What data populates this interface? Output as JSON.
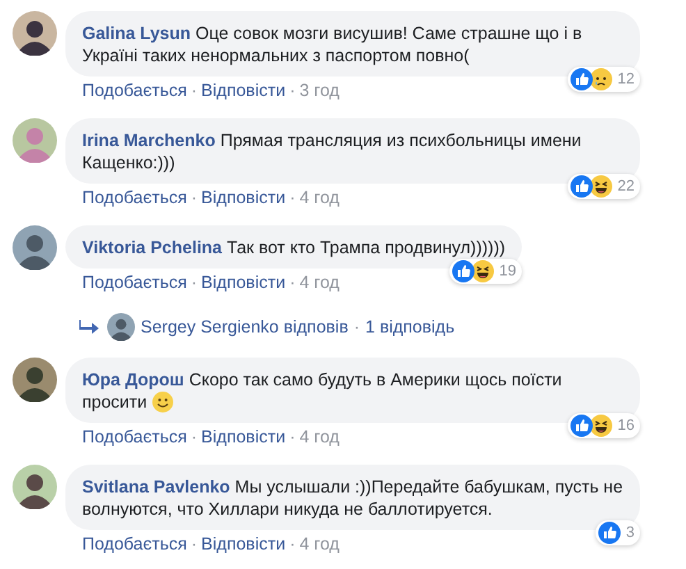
{
  "separator": "·",
  "comments": [
    {
      "author": "Galina Lysun",
      "text": "Оце совок мозги висушив! Саме страшне що і в Україні таких ненормальних з паспортом повно(",
      "reactions": [
        {
          "kind": "like"
        },
        {
          "kind": "sad"
        }
      ],
      "reaction_count": "12",
      "actions": [
        "Подобається",
        "Відповісти"
      ],
      "time": "3 год"
    },
    {
      "author": "Irina Marchenko",
      "text": "Прямая трансляция из психбольницы имени Кащенко:)))",
      "reactions": [
        {
          "kind": "like"
        },
        {
          "kind": "haha"
        }
      ],
      "reaction_count": "22",
      "actions": [
        "Подобається",
        "Відповісти"
      ],
      "time": "4 год"
    },
    {
      "author": "Viktoria Pchelina",
      "text": "Так вот кто Трампа продвинул))))))",
      "reactions": [
        {
          "kind": "like"
        },
        {
          "kind": "haha"
        }
      ],
      "reaction_count": "19",
      "actions": [
        "Подобається",
        "Відповісти"
      ],
      "time": "4 год",
      "replies": {
        "label": "Sergey Sergienko відповів",
        "count": "1 відповідь"
      }
    },
    {
      "author": "Юра Дорош",
      "text": "Скоро так само будуть в Америки щось поїсти просити",
      "emoji": {
        "kind": "smile"
      },
      "reactions": [
        {
          "kind": "like"
        },
        {
          "kind": "haha"
        }
      ],
      "reaction_count": "16",
      "actions": [
        "Подобається",
        "Відповісти"
      ],
      "time": "4 год"
    },
    {
      "author": "Svitlana Pavlenko",
      "text": "Мы услышали :))Передайте бабушкам, пусть не волнуются, что Хиллари никуда не баллотируется.",
      "reactions": [
        {
          "kind": "like"
        }
      ],
      "reaction_count": "3",
      "actions": [
        "Подобається",
        "Відповісти"
      ],
      "time": "4 год"
    }
  ]
}
